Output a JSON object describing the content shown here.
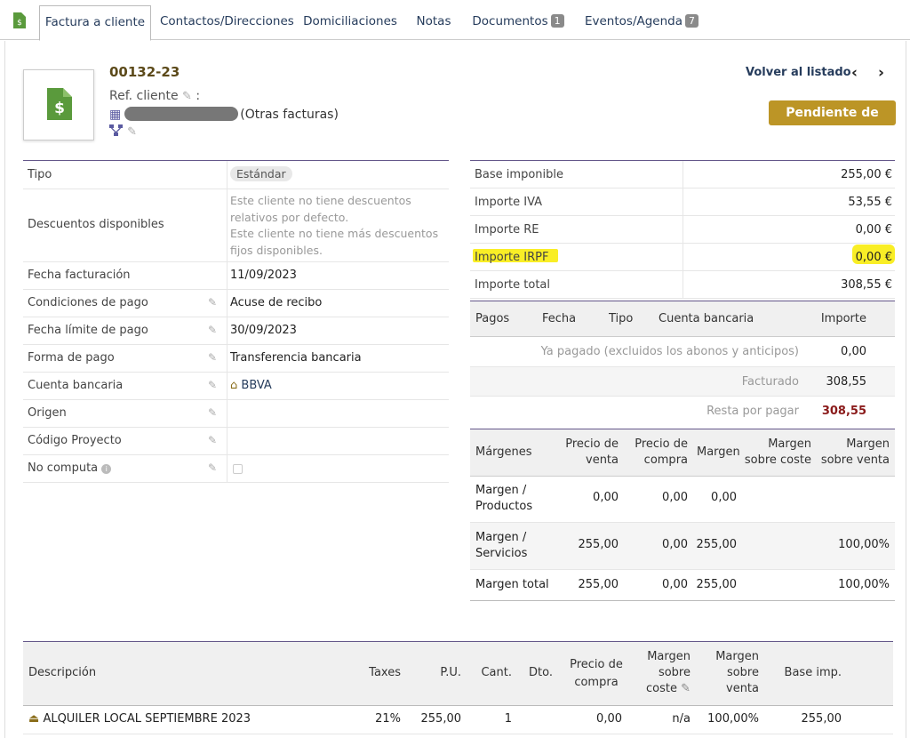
{
  "tabs": {
    "invoice": "Factura a cliente",
    "contacts": "Contactos/Direcciones",
    "debits": "Domiciliaciones",
    "notes": "Notas",
    "documents": "Documentos",
    "documents_count": "1",
    "events": "Eventos/Agenda",
    "events_count": "7"
  },
  "header": {
    "ref": "00132-23",
    "ref_client_label": "Ref. cliente",
    "ref_client_colon": ":",
    "other_invoices": "(Otras facturas)",
    "back_link": "Volver al listado",
    "prev": "‹",
    "next": "›",
    "status": "Pendiente de pago"
  },
  "fields": {
    "type_label": "Tipo",
    "type_value": "Estándar",
    "discounts_label": "Descuentos disponibles",
    "discounts_line1": "Este cliente no tiene descuentos",
    "discounts_line2": "relativos por defecto.",
    "discounts_line3": "Este cliente no tiene más descuentos",
    "discounts_line4": "fijos disponibles.",
    "date_label": "Fecha facturación",
    "date_value": "11/09/2023",
    "terms_label": "Condiciones de pago",
    "terms_value": "Acuse de recibo",
    "due_label": "Fecha límite de pago",
    "due_value": "30/09/2023",
    "method_label": "Forma de pago",
    "method_value": "Transferencia bancaria",
    "bank_label": "Cuenta bancaria",
    "bank_value": "BBVA",
    "origin_label": "Origen",
    "project_label": "Código Proyecto",
    "nocompute_label": "No computa"
  },
  "totals": {
    "base_label": "Base imponible",
    "base_value": "255,00 €",
    "iva_label": "Importe IVA",
    "iva_value": "53,55 €",
    "re_label": "Importe RE",
    "re_value": "0,00 €",
    "irpf_label": "Importe IRPF",
    "irpf_value": "0,00 €",
    "total_label": "Importe total",
    "total_value": "308,55 €"
  },
  "payments": {
    "h_pagos": "Pagos",
    "h_fecha": "Fecha",
    "h_tipo": "Tipo",
    "h_cuenta": "Cuenta bancaria",
    "h_importe": "Importe",
    "paid_label": "Ya pagado (excluidos los abonos y anticipos)",
    "paid_value": "0,00",
    "invoiced_label": "Facturado",
    "invoiced_value": "308,55",
    "remaining_label": "Resta por pagar",
    "remaining_value": "308,55"
  },
  "margins": {
    "h_margenes": "Márgenes",
    "h_pv1": "Precio de",
    "h_pv2": "venta",
    "h_pc1": "Precio de",
    "h_pc2": "compra",
    "h_margen": "Margen",
    "h_mc1": "Margen",
    "h_mc2": "sobre coste",
    "h_mv1": "Margen",
    "h_mv2": "sobre venta",
    "r1_l1": "Margen /",
    "r1_l2": "Productos",
    "r1_pv": "0,00",
    "r1_pc": "0,00",
    "r1_m": "0,00",
    "r2_l1": "Margen /",
    "r2_l2": "Servicios",
    "r2_pv": "255,00",
    "r2_pc": "0,00",
    "r2_m": "255,00",
    "r2_mv": "100,00%",
    "r3_l": "Margen total",
    "r3_pv": "255,00",
    "r3_pc": "0,00",
    "r3_m": "255,00",
    "r3_mv": "100,00%"
  },
  "lines": {
    "h_desc": "Descripción",
    "h_taxes": "Taxes",
    "h_pu": "P.U.",
    "h_cant": "Cant.",
    "h_dto": "Dto.",
    "h_pc1": "Precio de",
    "h_pc2": "compra",
    "h_mc1": "Margen",
    "h_mc2": "sobre",
    "h_mc3": "coste",
    "h_mv1": "Margen",
    "h_mv2": "sobre",
    "h_mv3": "venta",
    "h_base": "Base imp.",
    "l1_desc": "ALQUILER LOCAL SEPTIEMBRE 2023",
    "l1_tax": "21%",
    "l1_pu": "255,00",
    "l1_qty": "1",
    "l1_pc": "0,00",
    "l1_mc": "n/a",
    "l1_mv": "100,00%",
    "l1_base": "255,00"
  },
  "colors": {
    "accent": "#bc9526",
    "border": "#64578a",
    "highlight": "#f9ee26",
    "link": "#263c5c"
  }
}
